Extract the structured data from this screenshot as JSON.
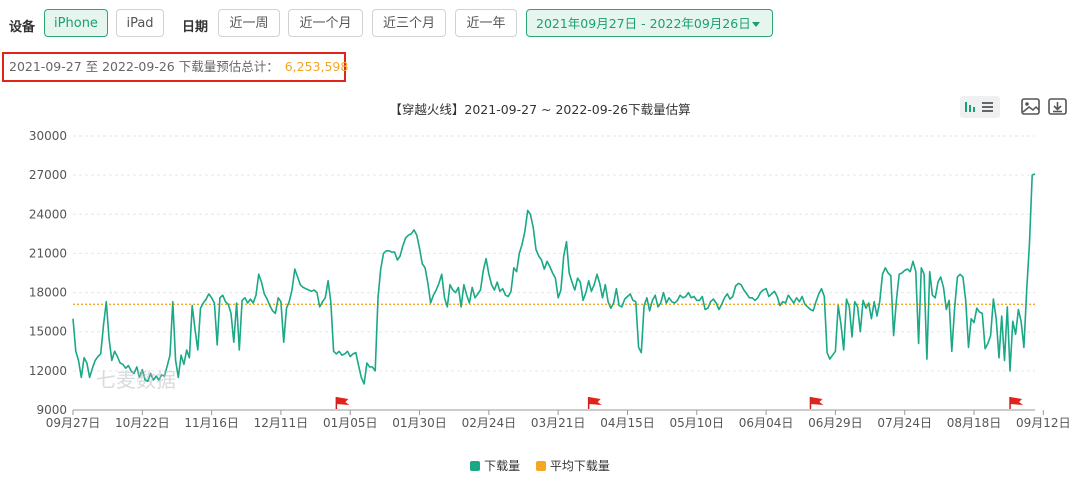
{
  "toolbar": {
    "device_label": "设备",
    "devices": [
      "iPhone",
      "iPad"
    ],
    "date_label": "日期",
    "ranges": [
      "近一周",
      "近一个月",
      "近三个月",
      "近一年"
    ],
    "date_range": "2021年09月27日 - 2022年09月26日"
  },
  "summary": {
    "text": "2021-09-27 至 2022-09-26 下载量预估总计：",
    "total": "6,253,598"
  },
  "watermark": "七麦数据",
  "colors": {
    "accent": "#2aa776",
    "series": "#1aa886",
    "avg": "#f5a623",
    "highlight": "#e0231b"
  },
  "icons": [
    "bar-chart-icon",
    "list-icon",
    "image-icon",
    "download-icon",
    "flag-icon"
  ],
  "chart_data": {
    "type": "line",
    "title": "【穿越火线】2021-09-27 ~ 2022-09-26下载量估算",
    "xlabel": "",
    "ylabel": "",
    "ylim": [
      9000,
      30000
    ],
    "yticks": [
      9000,
      12000,
      15000,
      18000,
      21000,
      24000,
      27000,
      30000
    ],
    "x_tick_labels": [
      "09月27日",
      "10月22日",
      "11月16日",
      "12月11日",
      "01月05日",
      "01月30日",
      "02月24日",
      "03月21日",
      "04月15日",
      "05月10日",
      "06月04日",
      "06月29日",
      "07月24日",
      "08月18日",
      "09月12日"
    ],
    "grid": true,
    "legend_position": "bottom-center",
    "flag_markers": [
      "01月01日",
      "04月01日",
      "06月15日",
      "09月01日"
    ],
    "series": [
      {
        "name": "下载量",
        "x_start": "2021-09-27",
        "x_end": "2022-09-26",
        "values": [
          16000,
          13500,
          12800,
          11500,
          13000,
          12600,
          11500,
          12200,
          12800,
          13100,
          13300,
          15500,
          17300,
          14500,
          12800,
          13500,
          13100,
          12600,
          12500,
          12200,
          12400,
          12000,
          11800,
          12300,
          11500,
          12100,
          11300,
          11200,
          11800,
          11300,
          11600,
          11300,
          11700,
          11600,
          12400,
          13200,
          17300,
          12800,
          11500,
          13200,
          12500,
          13600,
          13000,
          17000,
          15200,
          13600,
          16800,
          17200,
          17500,
          17900,
          17600,
          17200,
          14000,
          17600,
          17800,
          17300,
          17100,
          16400,
          14200,
          17200,
          13600,
          17400,
          17600,
          17200,
          17500,
          17200,
          17800,
          19400,
          18800,
          17900,
          17500,
          17000,
          16600,
          16400,
          17600,
          17300,
          14200,
          16800,
          17300,
          18200,
          19800,
          19200,
          18600,
          18400,
          18300,
          18200,
          18100,
          18200,
          18000,
          16900,
          17300,
          17600,
          18900,
          17300,
          13500,
          13300,
          13500,
          13200,
          13300,
          13500,
          13100,
          13300,
          13400,
          12400,
          11500,
          11000,
          12600,
          12300,
          12300,
          12000,
          17600,
          19800,
          21000,
          21200,
          21200,
          21100,
          21100,
          20500,
          20800,
          21600,
          22200,
          22400,
          22500,
          22800,
          22400,
          21400,
          20200,
          19900,
          18700,
          17200,
          17800,
          18200,
          18700,
          19400,
          17600,
          16900,
          18600,
          18200,
          18000,
          18400,
          16900,
          18600,
          17800,
          17200,
          18400,
          17600,
          17900,
          18200,
          19700,
          20600,
          19400,
          18600,
          18200,
          18800,
          18100,
          18300,
          17800,
          17700,
          18100,
          19900,
          19600,
          21000,
          21700,
          22700,
          24300,
          24000,
          23000,
          21300,
          20800,
          20500,
          19800,
          20400,
          20000,
          19500,
          19100,
          17600,
          18200,
          20800,
          21900,
          19500,
          18800,
          18200,
          19100,
          18800,
          17400,
          18000,
          18900,
          18100,
          18600,
          19400,
          18700,
          17600,
          18600,
          17300,
          16800,
          17200,
          18300,
          17000,
          16900,
          17500,
          17700,
          17900,
          17400,
          17300,
          13800,
          13400,
          17000,
          17600,
          16600,
          17400,
          17800,
          16900,
          17200,
          18000,
          17200,
          17600,
          17300,
          17200,
          17400,
          17800,
          17600,
          17700,
          18000,
          17600,
          17700,
          17400,
          17400,
          17700,
          16700,
          16800,
          17300,
          17500,
          17200,
          16700,
          17100,
          17600,
          17900,
          17500,
          17700,
          18500,
          18700,
          18600,
          18200,
          17900,
          17600,
          17600,
          17400,
          17600,
          18000,
          18200,
          18300,
          17700,
          17900,
          18100,
          17700,
          17000,
          17300,
          17200,
          17800,
          17500,
          17200,
          17600,
          17300,
          17700,
          17100,
          16900,
          16700,
          16600,
          17300,
          17900,
          18300,
          17700,
          13400,
          12900,
          13200,
          13500,
          17000,
          15600,
          13600,
          17500,
          16900,
          14600,
          17300,
          16900,
          15000,
          17400,
          16800,
          17200,
          16000,
          17300,
          16200,
          17300,
          19400,
          19900,
          19500,
          19300,
          14700,
          17400,
          19400,
          19500,
          19700,
          19800,
          19600,
          20400,
          19600,
          14100,
          19900,
          19400,
          12900,
          19600,
          17800,
          17600,
          18800,
          19200,
          18400,
          16700,
          17400,
          13500,
          16800,
          19200,
          19400,
          19200,
          17400,
          13800,
          16000,
          15700,
          16800,
          16500,
          16400,
          13700,
          14100,
          14700,
          17500,
          16000,
          13000,
          16200,
          12800,
          16900,
          12000,
          15800,
          14800,
          16700,
          15800,
          13800,
          18200,
          21800,
          27000,
          27100
        ],
        "avg": 17100
      },
      {
        "name": "平均下载量",
        "value": 17100
      }
    ]
  }
}
